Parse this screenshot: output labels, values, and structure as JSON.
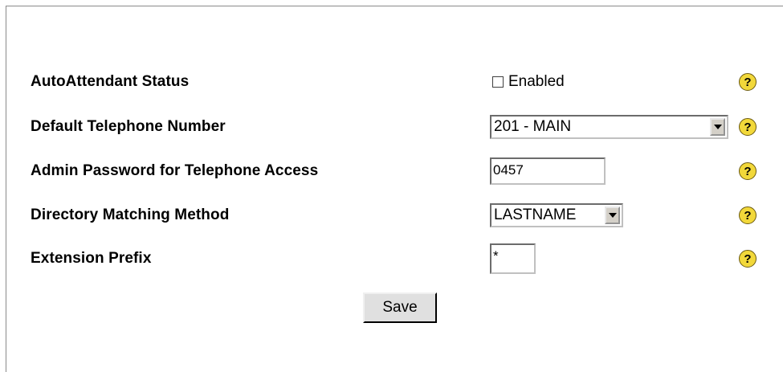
{
  "form": {
    "rows": [
      {
        "label": "AutoAttendant Status",
        "control": "checkbox",
        "checked": false,
        "checkbox_label": "Enabled"
      },
      {
        "label": "Default Telephone Number",
        "control": "select",
        "value": "201 - MAIN"
      },
      {
        "label": "Admin Password for Telephone Access",
        "control": "input",
        "value": "0457"
      },
      {
        "label": "Directory Matching Method",
        "control": "select",
        "value": "LASTNAME"
      },
      {
        "label": "Extension Prefix",
        "control": "input",
        "value": "*"
      }
    ],
    "help_symbol": "?",
    "save_label": "Save"
  },
  "icons": {
    "help": "help-question-icon",
    "dropdown": "chevron-down-icon"
  },
  "colors": {
    "help_icon": "#f2d83a",
    "button": "#e0e0e0"
  }
}
